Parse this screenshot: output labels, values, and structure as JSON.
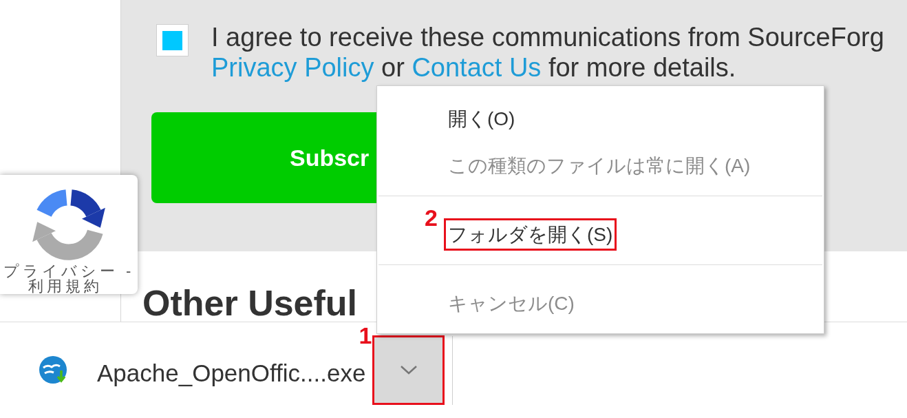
{
  "captcha_badge": {
    "links": [
      "プライバシー -",
      "利用規約"
    ]
  },
  "signup": {
    "consent": {
      "checked": true,
      "lines": [
        [
          {
            "kind": "text",
            "text": "I agree to receive these communications from SourceForg"
          }
        ],
        [
          {
            "kind": "link",
            "text": "Privacy Policy"
          },
          {
            "kind": "text",
            "text": " or "
          },
          {
            "kind": "link",
            "text": "Contact Us"
          },
          {
            "kind": "text",
            "text": " for more details."
          }
        ]
      ]
    },
    "subscribe_button": {
      "label": "Subscr"
    }
  },
  "section_heading": "Other Useful",
  "download_bar": {
    "file_name": "Apache_OpenOffic....exe",
    "menu_button": {
      "highlighted": true,
      "step": "1"
    }
  },
  "context_menu": {
    "items": [
      {
        "kind": "item",
        "label": "開く(O)",
        "disabled": false,
        "highlighted": false
      },
      {
        "kind": "item",
        "label": "この種類のファイルは常に開く(A)",
        "disabled": true,
        "highlighted": false
      },
      {
        "kind": "separator"
      },
      {
        "kind": "item",
        "label": "フォルダを開く(S)",
        "disabled": false,
        "highlighted": true,
        "step": "2"
      },
      {
        "kind": "separator"
      },
      {
        "kind": "item",
        "label": "キャンセル(C)",
        "disabled": true,
        "highlighted": false
      }
    ]
  }
}
